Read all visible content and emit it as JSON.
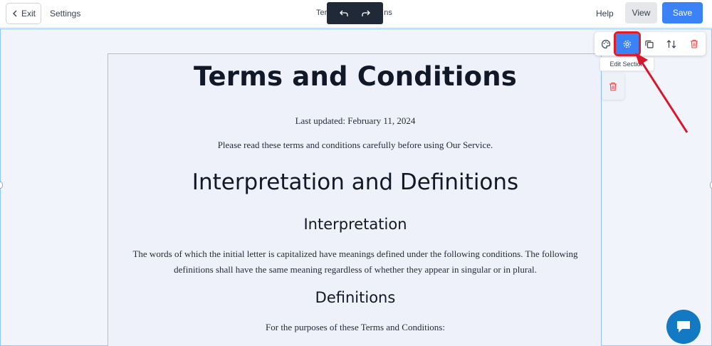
{
  "topbar": {
    "exit_label": "Exit",
    "settings_label": "Settings",
    "page_name_left": "Ter",
    "page_name_right": "ns",
    "help_label": "Help",
    "view_label": "View",
    "save_label": "Save"
  },
  "document": {
    "title": "Terms and Conditions",
    "last_updated": "Last updated: February 11, 2024",
    "intro": "Please read these terms and conditions carefully before using Our Service.",
    "heading_interpretation_definitions": "Interpretation and Definitions",
    "heading_interpretation": "Interpretation",
    "interpretation_text": "The words of which the initial letter is capitalized have meanings defined under the following conditions. The following definitions shall have the same meaning regardless of whether they appear in singular or in plural.",
    "heading_definitions": "Definitions",
    "purposes_text": "For the purposes of these Terms and Conditions:"
  },
  "section_toolbar": {
    "tooltip": "Edit Section",
    "icons": [
      "palette-icon",
      "gear-icon",
      "copy-icon",
      "move-icon",
      "trash-icon"
    ]
  },
  "colors": {
    "accent": "#3b82f6",
    "delete": "#ef4444",
    "highlight": "#e11d2a",
    "chat": "#1379c3"
  }
}
